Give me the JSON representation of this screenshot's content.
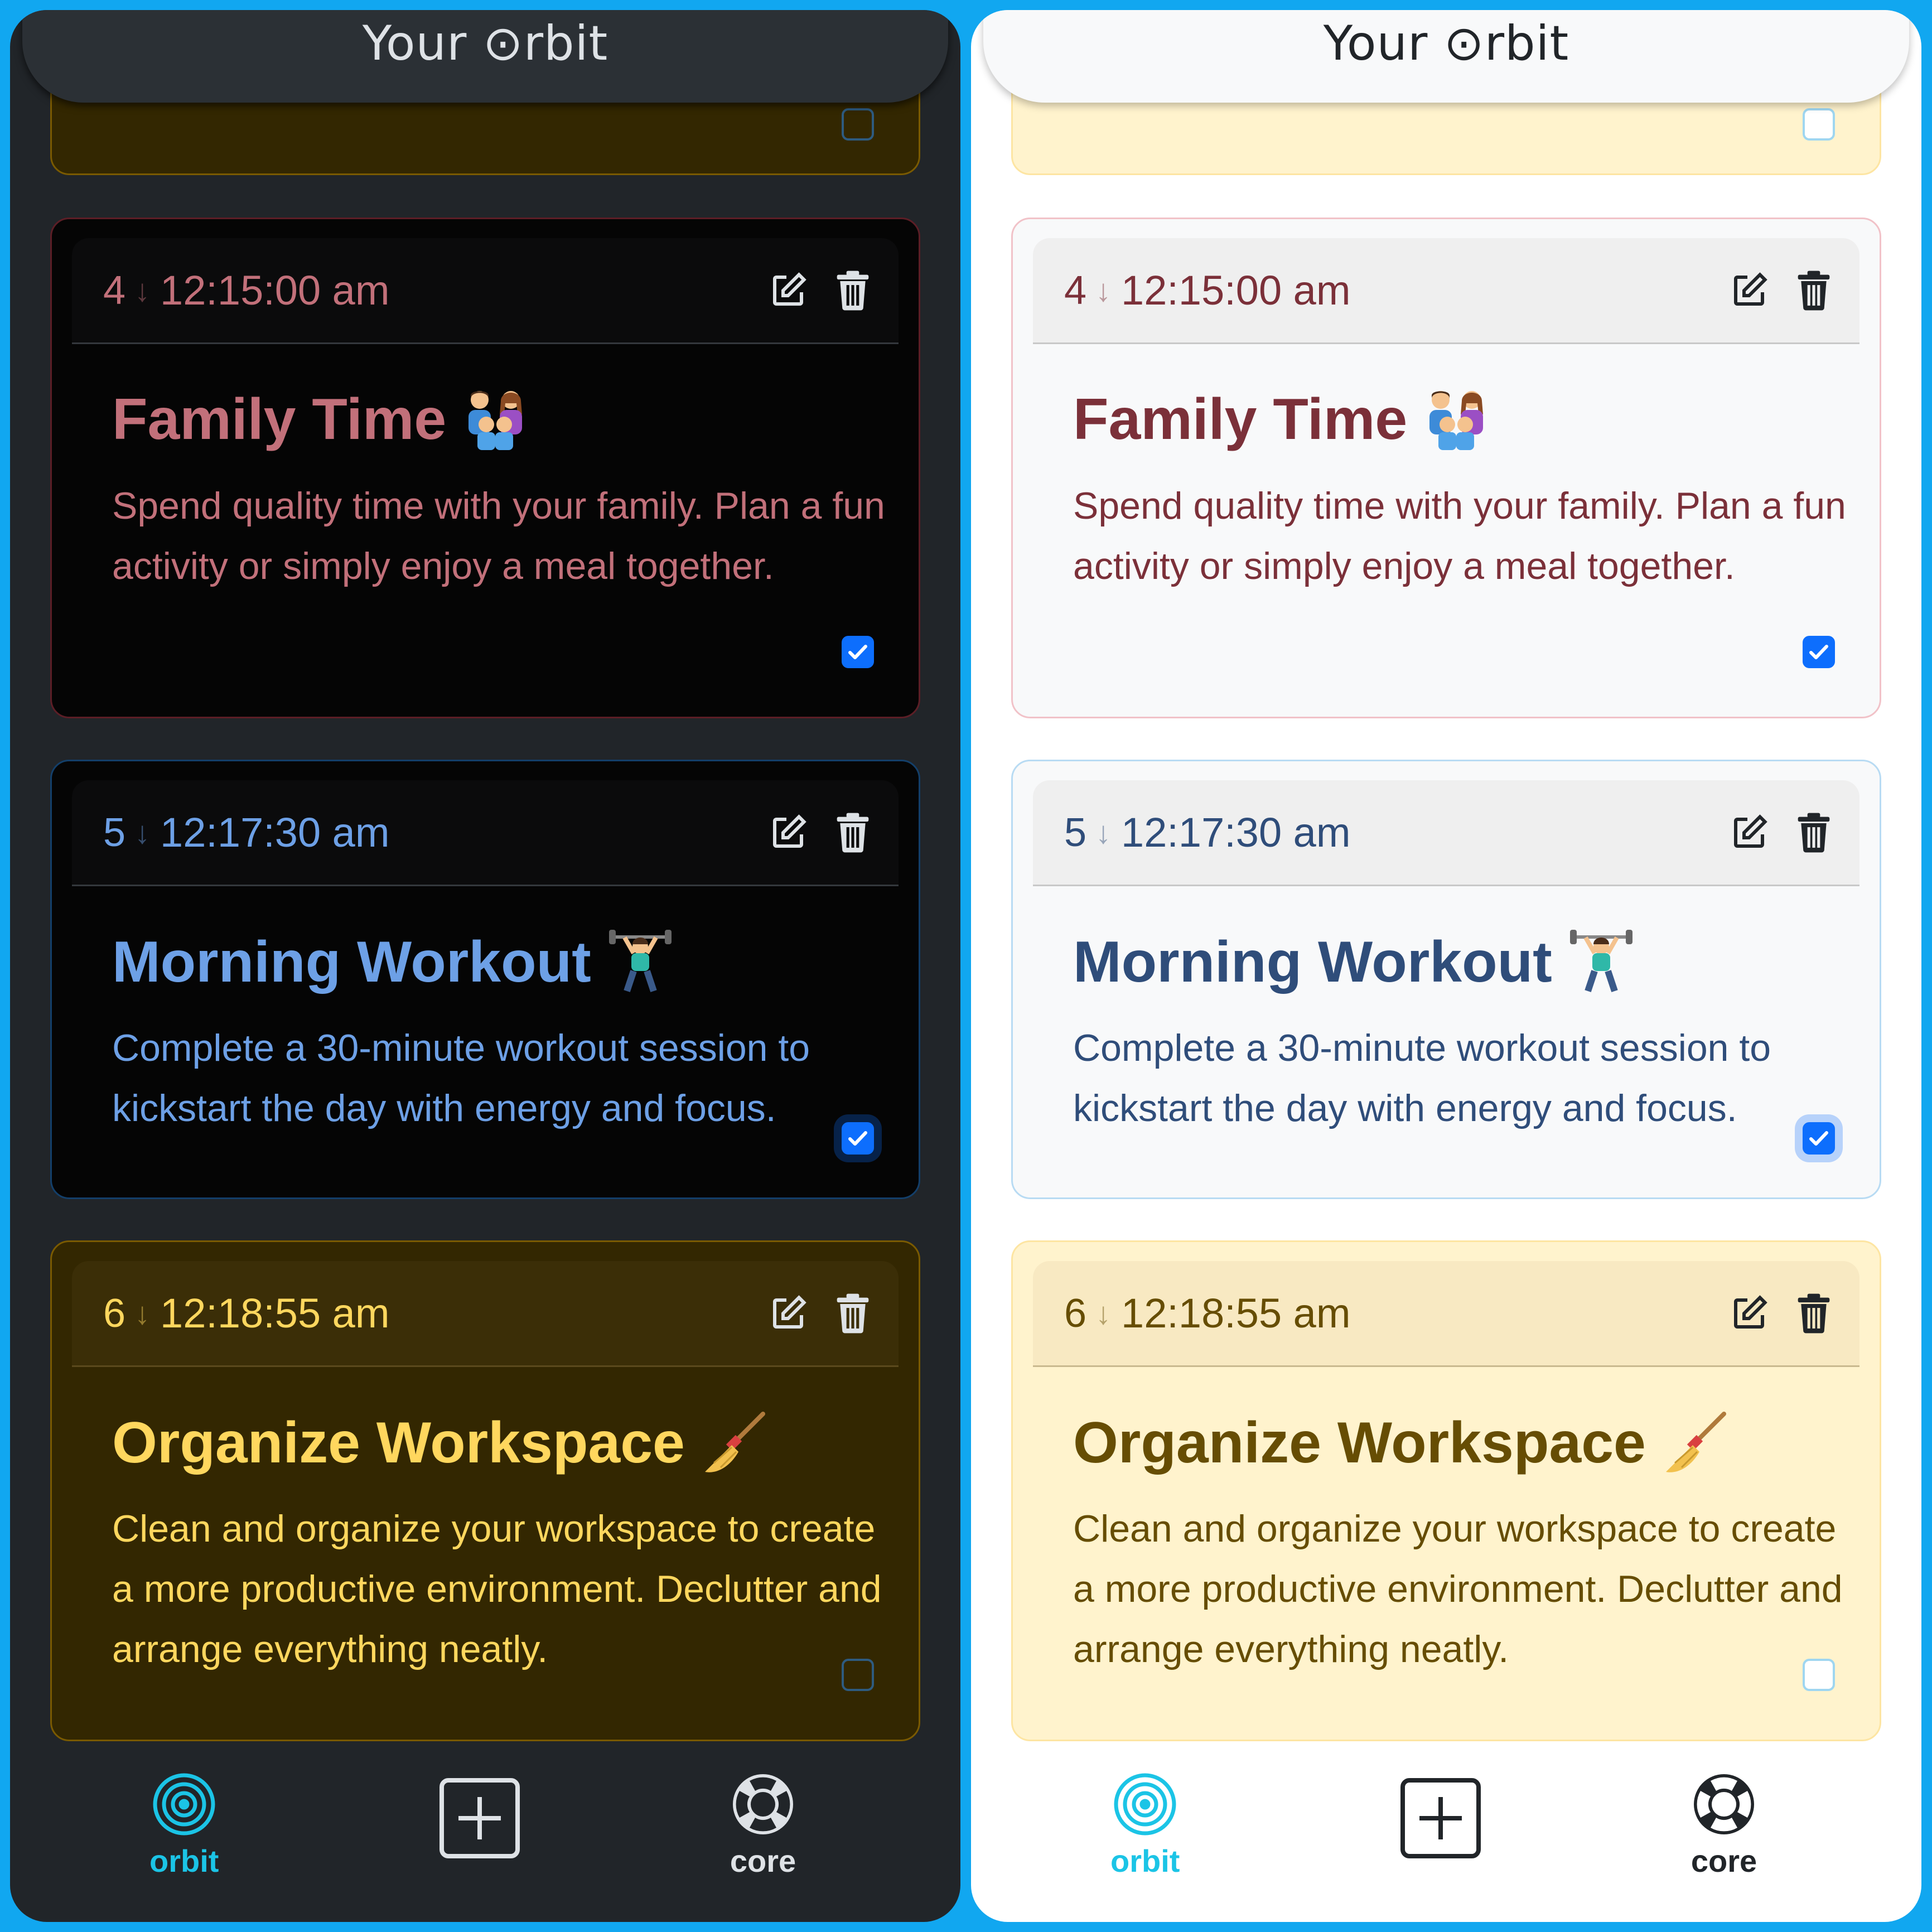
{
  "colors": {
    "background": "#11a7f0",
    "accent_cyan": "#1bc4e6",
    "checkbox_blue": "#0d6efd"
  },
  "panels": [
    {
      "theme": "dark",
      "header": {
        "title": "Your ⊙rbit"
      },
      "partial_card": {
        "checked": false
      },
      "cards": [
        {
          "index": "4",
          "arrow": "↓",
          "time": "12:15:00 am",
          "title": "Family Time",
          "emoji": "family-emoji",
          "description": "Spend quality time with your family. Plan a fun activity or simply enjoy a meal together.",
          "checked": true
        },
        {
          "index": "5",
          "arrow": "↓",
          "time": "12:17:30 am",
          "title": "Morning Workout",
          "emoji": "weightlifter-emoji",
          "description": "Complete a 30-minute workout session to kickstart the day with energy and focus.",
          "checked": true
        },
        {
          "index": "6",
          "arrow": "↓",
          "time": "12:18:55 am",
          "title": "Organize Workspace",
          "emoji": "broom-emoji",
          "description": "Clean and organize your workspace to create a more productive environment. Declutter and arrange everything neatly.",
          "checked": false
        }
      ],
      "nav": {
        "orbit_label": "orbit",
        "add_icon": "plus-square-icon",
        "core_label": "core"
      }
    },
    {
      "theme": "light",
      "header": {
        "title": "Your ⊙rbit"
      },
      "partial_card": {
        "checked": false
      },
      "cards": [
        {
          "index": "4",
          "arrow": "↓",
          "time": "12:15:00 am",
          "title": "Family Time",
          "emoji": "family-emoji",
          "description": "Spend quality time with your family. Plan a fun activity or simply enjoy a meal together.",
          "checked": true
        },
        {
          "index": "5",
          "arrow": "↓",
          "time": "12:17:30 am",
          "title": "Morning Workout",
          "emoji": "weightlifter-emoji",
          "description": "Complete a 30-minute workout session to kickstart the day with energy and focus.",
          "checked": true
        },
        {
          "index": "6",
          "arrow": "↓",
          "time": "12:18:55 am",
          "title": "Organize Workspace",
          "emoji": "broom-emoji",
          "description": "Clean and organize your workspace to create a more productive environment. Declutter and arrange everything neatly.",
          "checked": false
        }
      ],
      "nav": {
        "orbit_label": "orbit",
        "add_icon": "plus-square-icon",
        "core_label": "core"
      }
    }
  ]
}
